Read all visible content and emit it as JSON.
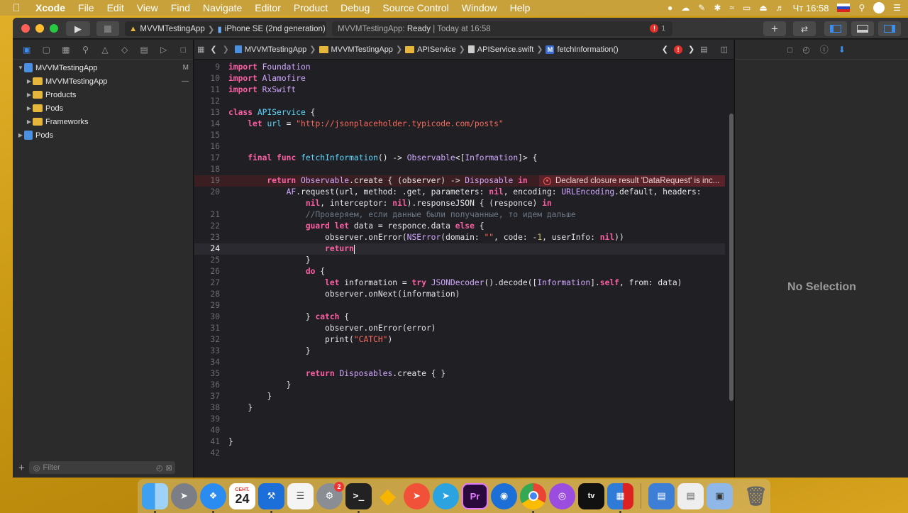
{
  "menubar": {
    "app": "Xcode",
    "items": [
      "File",
      "Edit",
      "View",
      "Find",
      "Navigate",
      "Editor",
      "Product",
      "Debug",
      "Source Control",
      "Window",
      "Help"
    ],
    "clock": "Чт 16:58"
  },
  "toolbar": {
    "scheme": "MVVMTestingApp",
    "device": "iPhone SE (2nd generation)",
    "status_app": "MVVMTestingApp:",
    "status_state": "Ready",
    "status_time": "| Today at 16:58",
    "error_count": "1"
  },
  "navigator": {
    "items": [
      {
        "label": "MVVMTestingApp",
        "flag": "M",
        "expanded": true,
        "kind": "project",
        "level": 0
      },
      {
        "label": "MVVMTestingApp",
        "flag": "—",
        "kind": "folder",
        "level": 1
      },
      {
        "label": "Products",
        "kind": "folder",
        "level": 1
      },
      {
        "label": "Pods",
        "kind": "folder",
        "level": 1
      },
      {
        "label": "Frameworks",
        "kind": "folder",
        "level": 1
      },
      {
        "label": "Pods",
        "kind": "project",
        "level": 0
      }
    ],
    "filter_placeholder": "Filter"
  },
  "jumpbar": {
    "path": [
      "MVVMTestingApp",
      "MVVMTestingApp",
      "APIService",
      "APIService.swift",
      "fetchInformation()"
    ]
  },
  "editor": {
    "current_line": 24,
    "error_line": 19,
    "error_message": "Declared closure result 'DataRequest' is inc...",
    "lines": [
      {
        "n": "9",
        "t": "import Foundation"
      },
      {
        "n": "10",
        "t": "import Alamofire"
      },
      {
        "n": "11",
        "t": "import RxSwift"
      },
      {
        "n": "12",
        "t": ""
      },
      {
        "n": "13",
        "t": "class APIService {"
      },
      {
        "n": "14",
        "t": "    let url = \"http://jsonplaceholder.typicode.com/posts\""
      },
      {
        "n": "15",
        "t": ""
      },
      {
        "n": "16",
        "t": ""
      },
      {
        "n": "17",
        "t": "    final func fetchInformation() -> Observable<[Information]> {"
      },
      {
        "n": "18",
        "t": ""
      },
      {
        "n": "19",
        "t": "        return Observable.create { (observer) -> Disposable in"
      },
      {
        "n": "20",
        "t": "            AF.request(url, method: .get, parameters: nil, encoding: URLEncoding.default, headers:"
      },
      {
        "n": "",
        "t": "                nil, interceptor: nil).responseJSON { (responce) in"
      },
      {
        "n": "21",
        "t": "                //Проверяем, если данные были получанные, то идем дальше"
      },
      {
        "n": "22",
        "t": "                guard let data = responce.data else {"
      },
      {
        "n": "23",
        "t": "                    observer.onError(NSError(domain: \"\", code: -1, userInfo: nil))"
      },
      {
        "n": "24",
        "t": "                    return"
      },
      {
        "n": "25",
        "t": "                }"
      },
      {
        "n": "26",
        "t": "                do {"
      },
      {
        "n": "27",
        "t": "                    let information = try JSONDecoder().decode([Information].self, from: data)"
      },
      {
        "n": "28",
        "t": "                    observer.onNext(information)"
      },
      {
        "n": "29",
        "t": ""
      },
      {
        "n": "30",
        "t": "                } catch {"
      },
      {
        "n": "31",
        "t": "                    observer.onError(error)"
      },
      {
        "n": "32",
        "t": "                    print(\"CATCH\")"
      },
      {
        "n": "33",
        "t": "                }"
      },
      {
        "n": "34",
        "t": ""
      },
      {
        "n": "35",
        "t": "                return Disposables.create { }"
      },
      {
        "n": "36",
        "t": "            }"
      },
      {
        "n": "37",
        "t": "        }"
      },
      {
        "n": "38",
        "t": "    }"
      },
      {
        "n": "39",
        "t": ""
      },
      {
        "n": "40",
        "t": ""
      },
      {
        "n": "41",
        "t": "}"
      },
      {
        "n": "42",
        "t": ""
      }
    ]
  },
  "inspector": {
    "empty_label": "No Selection"
  },
  "dock": {
    "calendar_month": "СЕНТ.",
    "calendar_day": "24",
    "sysprefs_badge": "2",
    "apps": [
      "finder",
      "launchpad",
      "safari",
      "calendar",
      "xcode",
      "reminders",
      "system-preferences",
      "terminal",
      "sketch",
      "swift-playgrounds",
      "telegram",
      "premiere",
      "maps-pin",
      "chrome",
      "podcasts",
      "appletv",
      "ide",
      "folder",
      "preview",
      "image-tool",
      "trash"
    ]
  },
  "colors": {
    "accent": "#3b8ef0",
    "keyword": "#fc5fa3",
    "string": "#fc6a5d",
    "error": "#e0302a",
    "folder": "#e5b63b"
  }
}
